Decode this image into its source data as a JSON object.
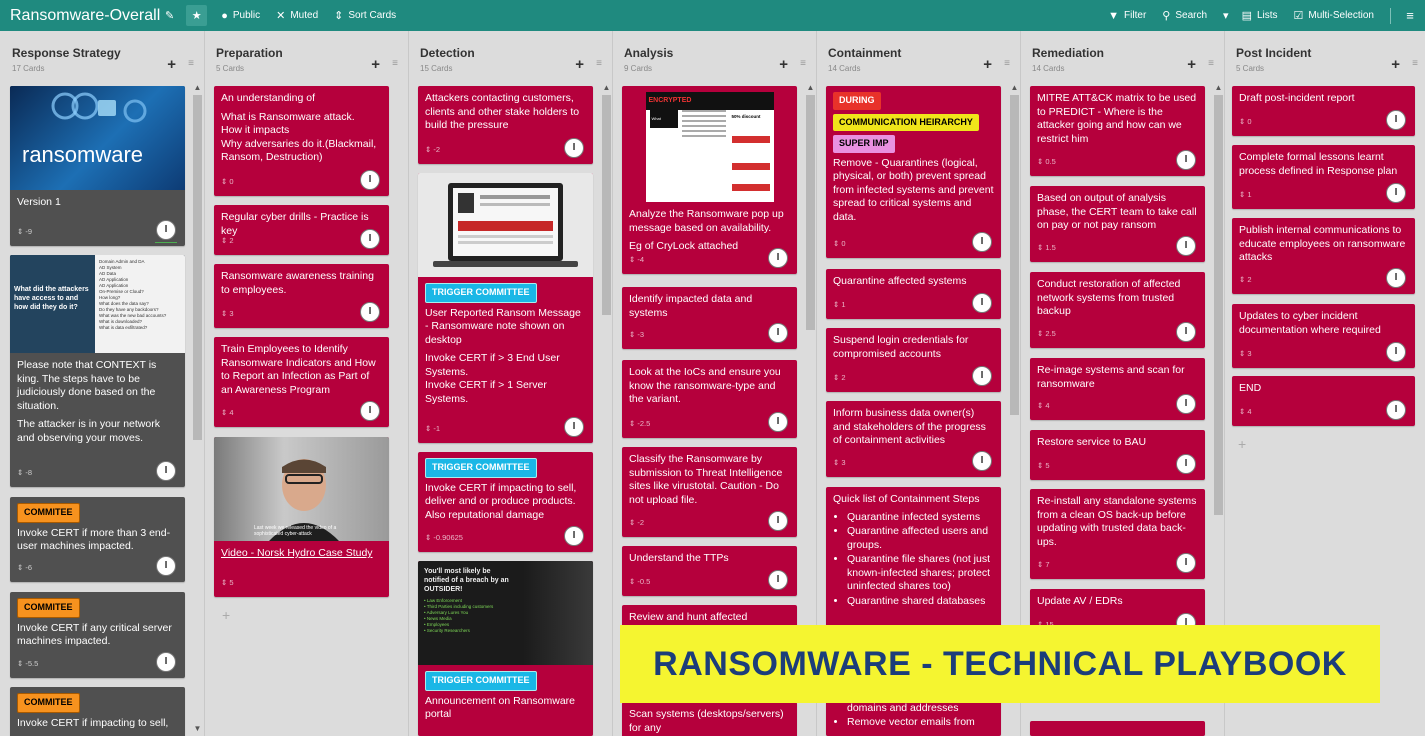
{
  "app": {
    "title": "Ransomware-Overall",
    "public_label": "Public",
    "muted_label": "Muted",
    "sort_label": "Sort Cards",
    "filter_label": "Filter",
    "search_label": "Search",
    "lists_label": "Lists",
    "multiselect_label": "Multi-Selection"
  },
  "lists": [
    {
      "title": "Response Strategy",
      "count": "17 Cards"
    },
    {
      "title": "Preparation",
      "count": "5 Cards"
    },
    {
      "title": "Detection",
      "count": "15 Cards"
    },
    {
      "title": "Analysis",
      "count": "9 Cards"
    },
    {
      "title": "Containment",
      "count": "14 Cards"
    },
    {
      "title": "Remediation",
      "count": "14 Cards"
    },
    {
      "title": "Post Incident",
      "count": "5 Cards"
    }
  ],
  "response": {
    "c1_img_text": "ransomware",
    "c1_text": "Version 1",
    "c1_meta": "⇕ -9",
    "c2_slide_title": "What did the attackers have access to and how did they do it?",
    "c2_slide_list": "Domain Admin and DA\nAD System\nAD Data\nAD Application\nAD Application\nOn-Premise or Cloud?\nHow long?\nWhat does the data say?\nDo they have any backdoors?\nWhat was the new bad accounts?\nWhat is downloaded?\nWhat is data exfiltrated?",
    "c2_text1": "Please note that CONTEXT is king. The steps have to be judiciously done based on the situation.",
    "c2_text2": "The attacker is in your network and observing your moves.",
    "c2_meta": "⇕ -8",
    "c3_badge": "COMMITEE",
    "c3_text": "Invoke CERT if more than 3 end-user machines impacted.",
    "c3_meta": "⇕ -6",
    "c4_badge": "COMMITEE",
    "c4_text": "Invoke CERT if any critical server machines impacted.",
    "c4_meta": "⇕ -5.5",
    "c5_badge": "COMMITEE",
    "c5_text": "Invoke CERT if impacting to sell,"
  },
  "preparation": {
    "c1_line1": "An understanding of",
    "c1_line2": "What is Ransomware attack.\nHow it impacts\nWhy adversaries do it.(Blackmail, Ransom, Destruction)",
    "c1_meta": "⇕ 0",
    "c2_text": "Regular cyber drills - Practice is key",
    "c2_meta": "⇕ 2",
    "c3_text": "Ransomware awareness training to employees.",
    "c3_meta": "⇕ 3",
    "c4_text": "Train Employees to Identify Ransomware Indicators and How to Report an Infection as Part of an Awareness Program",
    "c4_meta": "⇕ 4",
    "c5_caption": "Last week we released the video of a sophisticated cyber-attack",
    "c5_link": "Video - Norsk Hydro Case Study",
    "c5_meta": "⇕ 5"
  },
  "detection": {
    "c1_text": "Attackers contacting customers, clients and other stake holders to build the pressure",
    "c1_meta": "⇕ -2",
    "c2_badge": "TRIGGER COMMITTEE",
    "c2_text": "User Reported Ransom Message - Ransomware note shown on desktop",
    "c2_text2": "Invoke CERT if > 3 End User Systems.\nInvoke CERT if > 1 Server Systems.",
    "c2_meta": "⇕ -1",
    "c3_badge": "TRIGGER COMMITTEE",
    "c3_text": "Invoke CERT if impacting to sell, deliver and or produce products. Also reputational damage",
    "c3_meta": "⇕ -0.90625",
    "c4_img_text": "You'll most likely be notified of a breach by an OUTSIDER!",
    "c4_img_list": "• Law Enforcement\n• Third Parties including customers\n• Adversary Lures You\n• News Media\n• Employees\n• Security Researchers",
    "c4_badge": "TRIGGER COMMITTEE",
    "c4_text": "Announcement on Ransomware portal"
  },
  "analysis": {
    "c1_img_header": "ENCRYPTED",
    "c1_img_what": "What happened?",
    "c1_img_discount": "50% discount",
    "c1_text": "Analyze the Ransomware pop up message based on availability.",
    "c1_text2": "Eg of CryLock attached",
    "c1_meta": "⇕ -4",
    "c2_text": "Identify impacted data and systems",
    "c2_meta": "⇕ -3",
    "c3_text": "Look at the IoCs and ensure you know the ransomware-type and the variant.",
    "c3_meta": "⇕ -2.5",
    "c4_text": "Classify the Ransomware by submission to Threat Intelligence sites like virustotal. Caution - Do not upload file.",
    "c4_meta": "⇕ -2",
    "c5_text": "Understand the TTPs",
    "c5_meta": "⇕ -0.5",
    "c6_text": "Review and hunt affected",
    "c7_text": "Scan systems (desktops/servers) for any"
  },
  "containment": {
    "c1_badge1": "DURING",
    "c1_badge2": "COMMUNICATION HEIRARCHY",
    "c1_badge3": "SUPER IMP",
    "c1_text": "Remove - Quarantines (logical, physical, or both) prevent spread from infected systems and prevent spread to critical systems and data.",
    "c1_meta": "⇕ 0",
    "c2_text": "Quarantine affected systems",
    "c2_meta": "⇕ 1",
    "c3_text": "Suspend login credentials for compromised accounts",
    "c3_meta": "⇕ 2",
    "c4_text": "Inform business data owner(s) and stakeholders of the progress of containment activities",
    "c4_meta": "⇕ 3",
    "c5_text": "Quick list of Containment Steps",
    "c5_items": [
      "Quarantine infected systems",
      "Quarantine affected users and groups.",
      "Quarantine file shares (not just known-infected shares; protect uninfected shares too)",
      "Quarantine shared databases"
    ],
    "c5_tail1": "domains and addresses",
    "c5_tail2": "Remove vector emails from"
  },
  "remediation": {
    "c1_text": "MITRE ATT&CK matrix to be used to PREDICT - Where is the attacker going and how can we restrict him",
    "c1_meta": "⇕ 0.5",
    "c2_text": "Based on output of analysis phase, the CERT team to take call on pay or not pay ransom",
    "c2_meta": "⇕ 1.5",
    "c3_text": "Conduct restoration of affected network systems from trusted backup",
    "c3_meta": "⇕ 2.5",
    "c4_text": "Re-image systems and scan for ransomware",
    "c4_meta": "⇕ 4",
    "c5_text": "Restore service to BAU",
    "c5_meta": "⇕ 5",
    "c6_text": "Re-install any standalone systems from a clean OS back-up before updating with trusted data back-ups.",
    "c6_meta": "⇕ 7",
    "c7_text": "Update AV / EDRs",
    "c7_meta": "⇕ 15"
  },
  "post": {
    "c1_text": "Draft post-incident report",
    "c1_meta": "⇕ 0",
    "c2_text": "Complete formal lessons learnt process defined in Response plan",
    "c2_meta": "⇕ 1",
    "c3_text": "Publish internal communications to educate employees on ransomware attacks",
    "c3_meta": "⇕ 2",
    "c4_text": "Updates to cyber incident documentation where required",
    "c4_meta": "⇕ 3",
    "c5_text": "END",
    "c5_meta": "⇕ 4"
  },
  "banner": "RANSOMWARE - TECHNICAL PLAYBOOK",
  "avatar_letter": "I",
  "icons": [
    "edit-icon",
    "star-icon",
    "globe-icon",
    "mute-icon",
    "sort-icon",
    "filter-icon",
    "search-icon",
    "lists-icon",
    "multiselect-icon",
    "hamburger-icon",
    "plus-icon",
    "menu-icon"
  ],
  "colors": {
    "header": "#1f8a7f",
    "card_red": "#b5003c",
    "card_dark": "#505050",
    "banner": "#f5f530",
    "banner_text": "#1c3d7a"
  }
}
